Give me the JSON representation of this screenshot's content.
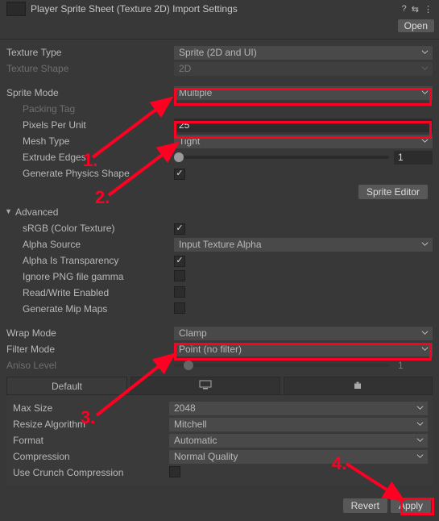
{
  "header": {
    "title": "Player Sprite Sheet (Texture 2D) Import Settings",
    "open_btn": "Open"
  },
  "texture_type": {
    "label": "Texture Type",
    "value": "Sprite (2D and UI)"
  },
  "texture_shape": {
    "label": "Texture Shape",
    "value": "2D"
  },
  "sprite_mode": {
    "label": "Sprite Mode",
    "value": "Multiple"
  },
  "packing_tag": {
    "label": "Packing Tag"
  },
  "pixels_per_unit": {
    "label": "Pixels Per Unit",
    "value": "25"
  },
  "mesh_type": {
    "label": "Mesh Type",
    "value": "Tight"
  },
  "extrude_edges": {
    "label": "Extrude Edges",
    "value": "1"
  },
  "generate_physics_shape": {
    "label": "Generate Physics Shape"
  },
  "sprite_editor_btn": "Sprite Editor",
  "advanced": {
    "label": "Advanced",
    "srgb": {
      "label": "sRGB (Color Texture)"
    },
    "alpha_source": {
      "label": "Alpha Source",
      "value": "Input Texture Alpha"
    },
    "alpha_is_transparency": {
      "label": "Alpha Is Transparency"
    },
    "ignore_png_gamma": {
      "label": "Ignore PNG file gamma"
    },
    "read_write": {
      "label": "Read/Write Enabled"
    },
    "generate_mipmaps": {
      "label": "Generate Mip Maps"
    }
  },
  "wrap_mode": {
    "label": "Wrap Mode",
    "value": "Clamp"
  },
  "filter_mode": {
    "label": "Filter Mode",
    "value": "Point (no filter)"
  },
  "aniso_level": {
    "label": "Aniso Level",
    "value": "1"
  },
  "tabs": {
    "default": "Default"
  },
  "platform": {
    "max_size": {
      "label": "Max Size",
      "value": "2048"
    },
    "resize_algorithm": {
      "label": "Resize Algorithm",
      "value": "Mitchell"
    },
    "format": {
      "label": "Format",
      "value": "Automatic"
    },
    "compression": {
      "label": "Compression",
      "value": "Normal Quality"
    },
    "use_crunch": {
      "label": "Use Crunch Compression"
    }
  },
  "footer": {
    "revert": "Revert",
    "apply": "Apply"
  },
  "annotations": {
    "n1": "1.",
    "n2": "2.",
    "n3": "3.",
    "n4": "4."
  }
}
